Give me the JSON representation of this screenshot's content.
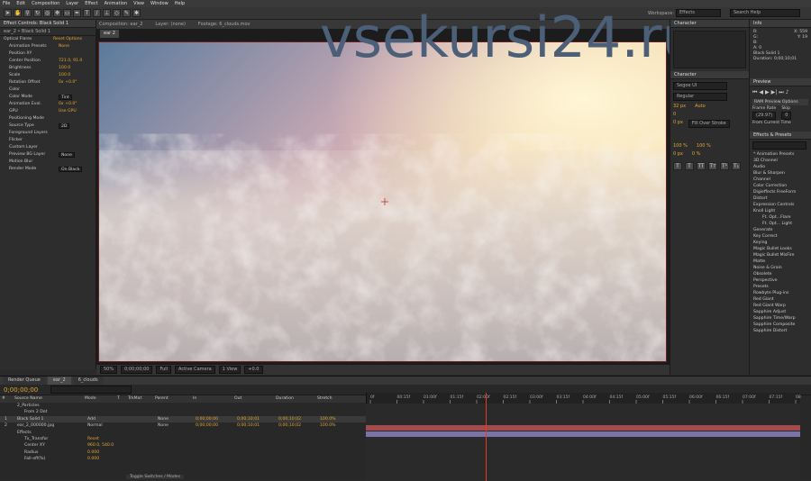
{
  "menu": [
    "File",
    "Edit",
    "Composition",
    "Layer",
    "Effect",
    "Animation",
    "View",
    "Window",
    "Help"
  ],
  "toolbar": {
    "workspace_label": "Workspace:",
    "workspace_value": "Effects",
    "search_value": "Search Help"
  },
  "effect_controls": {
    "tab": "Effect Controls: Black Solid 1",
    "breadcrumb": "ear_2 • Black Solid 1",
    "rows": [
      {
        "name": "Optical Flares",
        "value": "Reset  Options"
      },
      {
        "name": "Animation Presets",
        "value": "None"
      },
      {
        "name": "Position XY",
        "value": ""
      },
      {
        "name": "Center Position",
        "value": "721.0, 91.0"
      },
      {
        "name": "Brightness",
        "value": "100.0"
      },
      {
        "name": "Scale",
        "value": "100.0"
      },
      {
        "name": "Rotation Offset",
        "value": "0x +0.0°"
      },
      {
        "name": "Color",
        "value": ""
      },
      {
        "name": "Color Mode",
        "value": "Tint"
      },
      {
        "name": "Animation Evol.",
        "value": "0x +0.0°"
      },
      {
        "name": "GPU",
        "value": "Use GPU"
      },
      {
        "name": "Positioning Mode",
        "value": ""
      },
      {
        "name": "Source Type",
        "value": "2D"
      },
      {
        "name": "Foreground Layers",
        "value": ""
      },
      {
        "name": "Flicker",
        "value": ""
      },
      {
        "name": "Custom Layer",
        "value": ""
      },
      {
        "name": "Preview BG Layer",
        "value": "None"
      },
      {
        "name": "Motion Blur",
        "value": ""
      },
      {
        "name": "Render Mode",
        "value": "On Black"
      }
    ]
  },
  "composition": {
    "tabs": [
      "Composition: ear_2",
      "Layer: (none)",
      "Footage: 6_clouds.mov"
    ],
    "view_tab": "ear 2",
    "viewer_controls": [
      "50%",
      "0;00;00;00",
      "Full",
      "Active Camera",
      "1 View",
      "+0.0"
    ]
  },
  "watermark": "vsekursi24.ru",
  "character": {
    "tab": "Character",
    "font": "Segoe UI",
    "style": "Regular",
    "size": "32 px",
    "leading": "Auto",
    "tracking": "0",
    "stroke": "0 px",
    "stroke_mode": "Fill Over Stroke",
    "scale_v": "100 %",
    "scale_h": "100 %",
    "baseline": "0 px",
    "tsume": "0 %",
    "format_buttons": [
      "T",
      "T",
      "TT",
      "Tт",
      "T¹",
      "T₁"
    ]
  },
  "info": {
    "tab": "Info",
    "r": "R:",
    "g": "G:",
    "b": "B:",
    "a": "A: 0",
    "x": "X: 559",
    "y": "Y: 19",
    "layer": "Black Solid 1",
    "duration": "Duration: 0;00;10;01"
  },
  "preview": {
    "tab": "Preview",
    "ram_options": "RAM Preview Options",
    "frame_rate_label": "Frame Rate",
    "skip_label": "Skip",
    "frame_rate": "(29.97)",
    "skip": "0",
    "from_current": "From Current Time"
  },
  "effects_presets": {
    "tab": "Effects & Presets",
    "search": "",
    "items": [
      "* Animation Presets",
      "3D Channel",
      "Audio",
      "Blur & Sharpen",
      "Channel",
      "Color Correction",
      "Digieffects FreeForm",
      "Distort",
      "Expression Controls",
      "Knoll Light",
      "Ft. Opt...Flare",
      "Ft. Opt... Light",
      "Generate",
      "Key Correct",
      "Keying",
      "Magic Bullet Looks",
      "Magic Bullet MisFire",
      "Matte",
      "Noise & Grain",
      "Obsolete",
      "Perspective",
      "Presets",
      "Rowbyte Plug-ins",
      "Red Giant",
      "Red Giant Warp",
      "Sapphire Adjust",
      "Sapphire Time/Warp",
      "Sapphire Composite",
      "Sapphire Distort"
    ]
  },
  "timeline": {
    "tabs": [
      "Render Queue",
      "ear_2",
      "6_clouds"
    ],
    "timecode": "0;00;00;00",
    "search": "",
    "col_headers": [
      "#",
      "Source Name",
      "Mode",
      "T",
      "TrkMat",
      "Parent",
      "In",
      "Out",
      "Duration",
      "Stretch"
    ],
    "ruler": [
      "0f",
      "00:15f",
      "01:00f",
      "01:15f",
      "02:00f",
      "02:15f",
      "03:00f",
      "03:15f",
      "04:00f",
      "04:15f",
      "05:00f",
      "05:15f",
      "06:00f",
      "06:15f",
      "07:00f",
      "07:15f",
      "08:00f"
    ],
    "layers": [
      {
        "num": "",
        "name": "2_Particles",
        "mode": "",
        "parent": "",
        "in": "",
        "out": "",
        "dur": "",
        "stretch": ""
      },
      {
        "num": "",
        "name": "From 2 Dot",
        "mode": "",
        "parent": "",
        "in": "",
        "out": "",
        "dur": "",
        "stretch": ""
      },
      {
        "num": "1",
        "name": "Black Solid 1",
        "mode": "Add",
        "parent": "None",
        "in": "0;00;00;00",
        "out": "0;00;10;01",
        "dur": "0;00;10;02",
        "stretch": "100.0%"
      },
      {
        "num": "2",
        "name": "ear_2_000000.jpg",
        "mode": "Normal",
        "parent": "None",
        "in": "0;00;00;00",
        "out": "0;00;10;01",
        "dur": "0;00;10;02",
        "stretch": "100.0%"
      },
      {
        "num": "",
        "name": "Effects",
        "mode": "",
        "parent": "",
        "in": "",
        "out": "",
        "dur": "",
        "stretch": ""
      },
      {
        "num": "",
        "name": "Tx_Transfor",
        "mode": "Reset",
        "parent": "",
        "in": "",
        "out": "",
        "dur": "",
        "stretch": ""
      },
      {
        "num": "",
        "name": "Center XY",
        "mode": "960.0, 540.0",
        "parent": "",
        "in": "",
        "out": "",
        "dur": "",
        "stretch": ""
      },
      {
        "num": "",
        "name": "Radius",
        "mode": "0.000",
        "parent": "",
        "in": "",
        "out": "",
        "dur": "",
        "stretch": ""
      },
      {
        "num": "",
        "name": "Fall-off(%)",
        "mode": "0.000",
        "parent": "",
        "in": "",
        "out": "",
        "dur": "",
        "stretch": ""
      }
    ],
    "toggle_label": "Toggle Switches / Modes"
  },
  "colors": {
    "accent": "#e4a630",
    "bar_red": "#a34a4c",
    "bar_purple": "#7b72a8",
    "playhead": "#d8402a",
    "frame_border": "#6a2020"
  }
}
